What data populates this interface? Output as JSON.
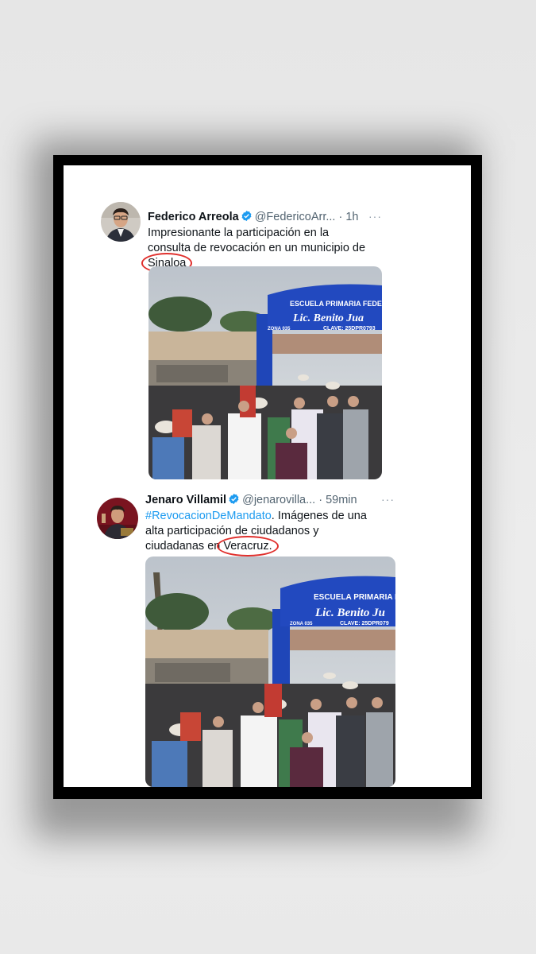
{
  "tweets": [
    {
      "name": "Federico Arreola",
      "handle": "@FedericoArr...",
      "separator": "·",
      "time": "1h",
      "more": "···",
      "text_line1": "Impresionante la participación en la",
      "text_line2": "consulta de revocación en un municipio de",
      "highlight": "Sinaloa",
      "sign_line1": "ESCUELA PRIMARIA FEDE",
      "sign_line2": "Lic. Benito Jua",
      "sign_zone": "ZONA 035",
      "sign_clave": "CLAVE: 25DPR0793"
    },
    {
      "name": "Jenaro Villamil",
      "handle": "@jenarovilla...",
      "separator": "·",
      "time": "59min",
      "more": "···",
      "hashtag": "#RevocacionDeMandato",
      "text_after_hashtag": ". Imágenes de una",
      "text_line2": "alta participación de ciudadanos y",
      "text_line3_prefix": "ciudadanas en ",
      "highlight": "Veracruz.",
      "sign_line1": "ESCUELA PRIMARIA F",
      "sign_line2": "Lic. Benito Ju",
      "sign_zone": "ZONA 035",
      "sign_clave": "CLAVE: 25DPR079"
    }
  ],
  "colors": {
    "verified": "#1d9bf0",
    "circle": "#e0302d",
    "hashtag": "#1d9bf0"
  },
  "icons": {
    "verified": "verified-badge-icon",
    "more": "more-options-icon"
  }
}
